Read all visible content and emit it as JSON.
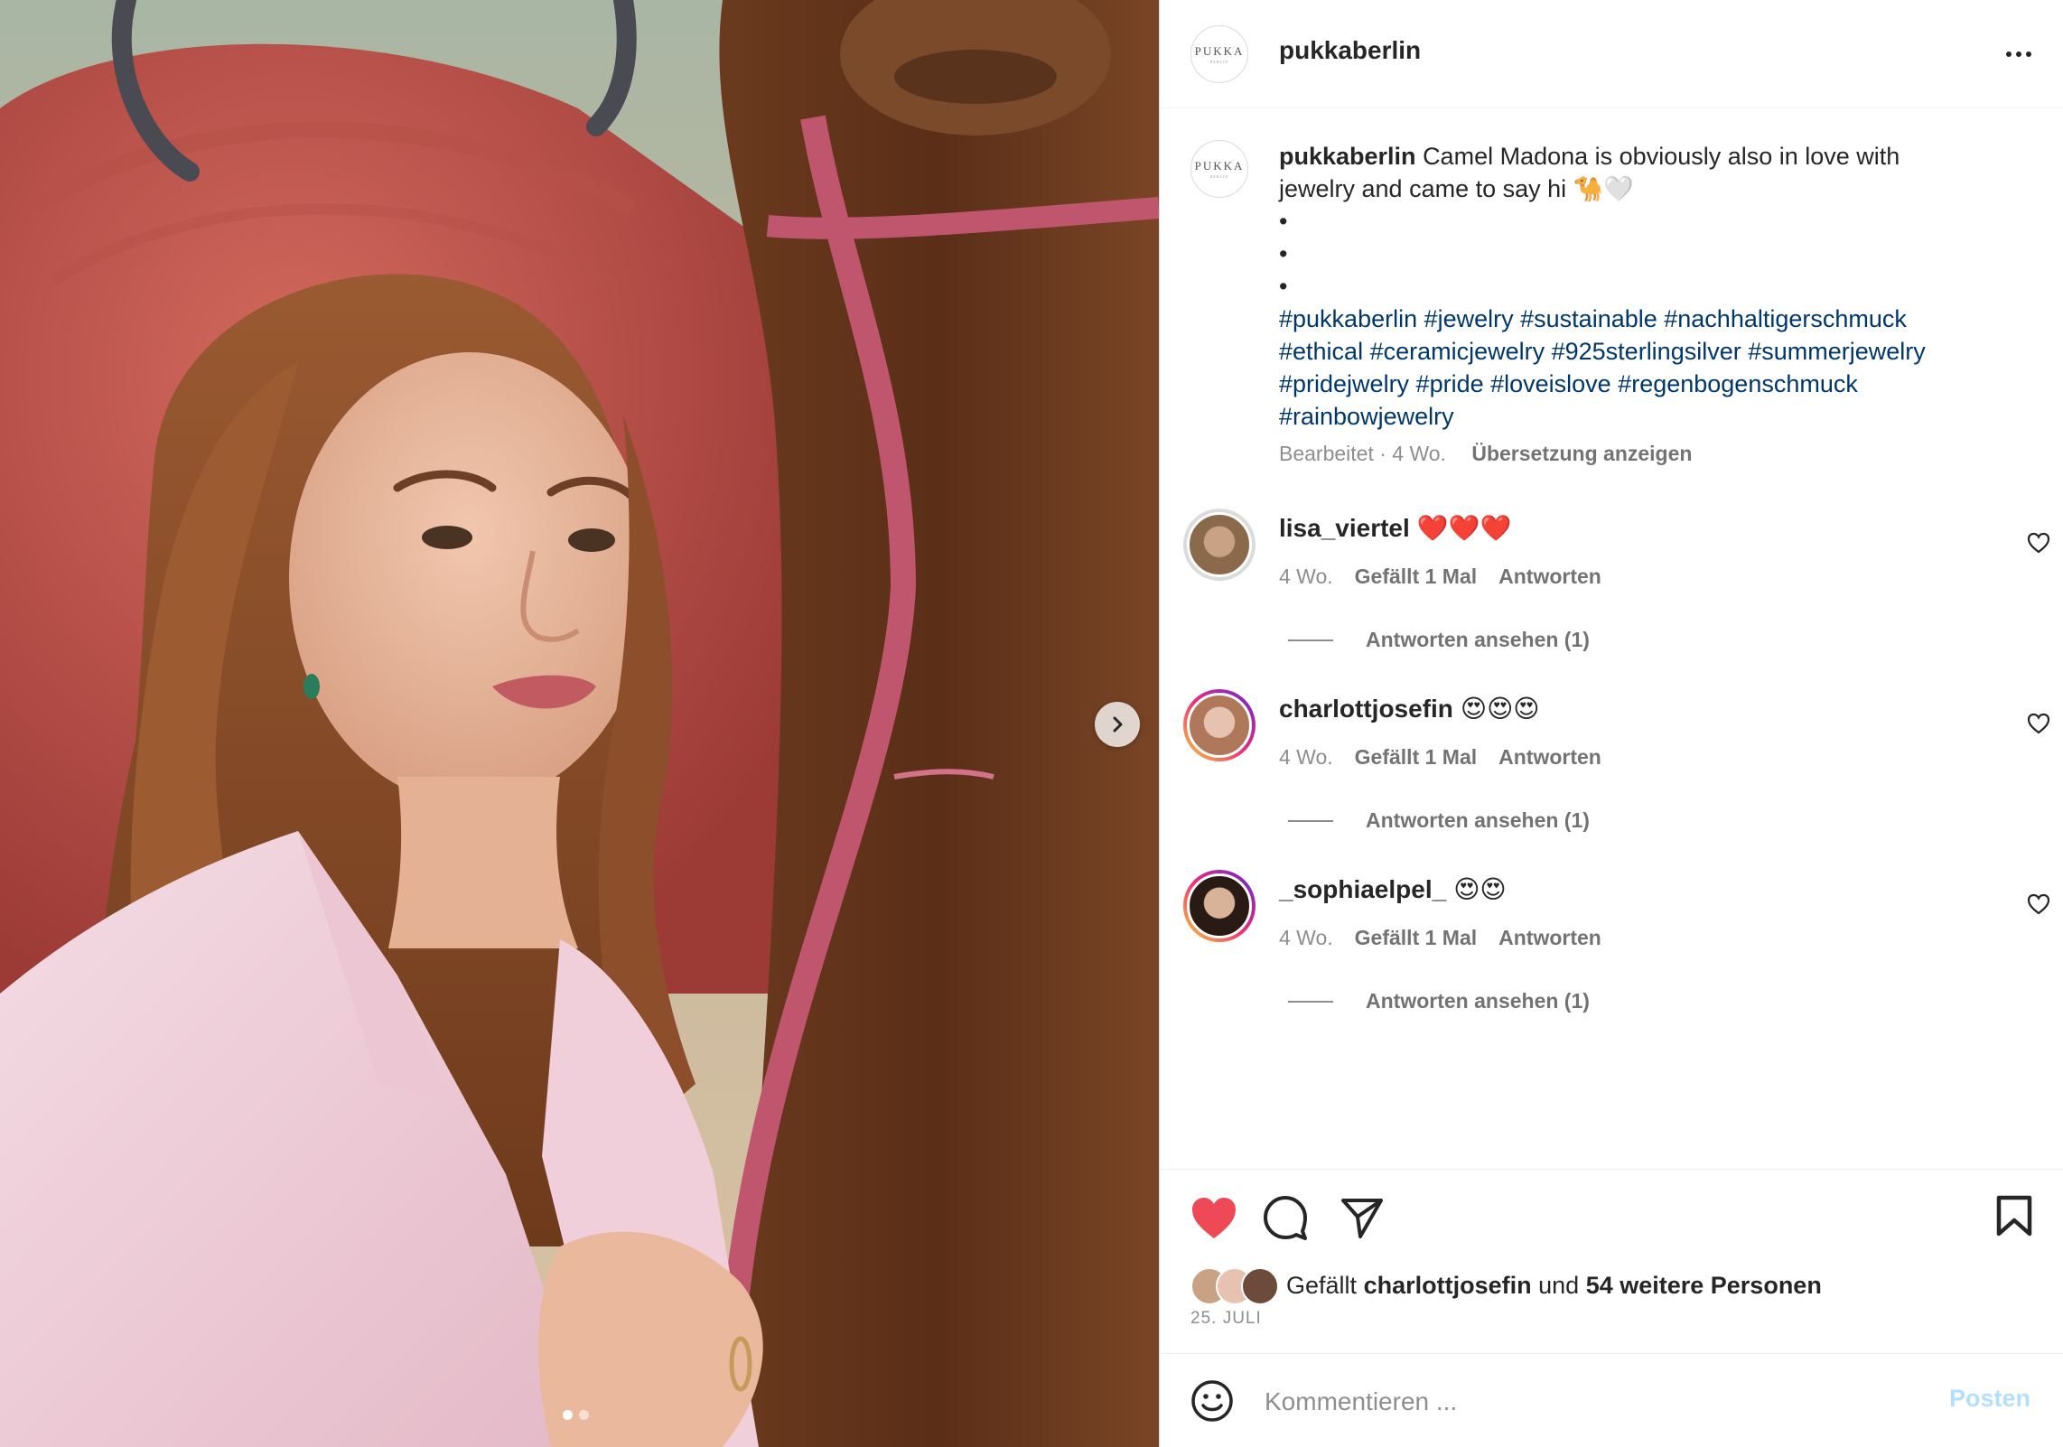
{
  "post": {
    "username": "pukkaberlin",
    "avatar_text": "PUKKA",
    "avatar_subtext": "BERLIN"
  },
  "caption": {
    "username": "pukkaberlin",
    "text_line1": "Camel Madona is obviously also in love with",
    "text_line2": "jewelry and came to say hi 🐪🤍",
    "bullets": [
      "•",
      "•",
      "•"
    ],
    "hashtags": [
      "#pukkaberlin #jewelry #sustainable #nachhaltigerschmuck",
      "#ethical #ceramicjewelry #925sterlingsilver #summerjewelry",
      "#pridejwelry #pride #loveislove #regenbogenschmuck",
      "#rainbowjewelry"
    ],
    "edited": "Bearbeitet · 4 Wo.",
    "translate": "Übersetzung anzeigen"
  },
  "comments": [
    {
      "username": "lisa_viertel",
      "text": "❤️❤️❤️",
      "age": "4 Wo.",
      "likes": "Gefällt 1 Mal",
      "reply": "Antworten",
      "view_replies": "Antworten ansehen (1)",
      "story_ring": false,
      "avatar_skin": "#c9a184",
      "avatar_hair": "#8a6a4a"
    },
    {
      "username": "charlottjosefin",
      "text": "😍😍😍",
      "age": "4 Wo.",
      "likes": "Gefällt 1 Mal",
      "reply": "Antworten",
      "view_replies": "Antworten ansehen (1)",
      "story_ring": true,
      "avatar_skin": "#e8c2b0",
      "avatar_hair": "#b0785a"
    },
    {
      "username": "_sophiaelpel_",
      "text": "😍😍",
      "age": "4 Wo.",
      "likes": "Gefällt 1 Mal",
      "reply": "Antworten",
      "view_replies": "Antworten ansehen (1)",
      "story_ring": true,
      "avatar_skin": "#d9b29a",
      "avatar_hair": "#2a1a14"
    }
  ],
  "likes": {
    "prefix": "Gefällt",
    "user": "charlottjosefin",
    "middle": "und",
    "others": "54 weitere Personen"
  },
  "date": "25. JULI",
  "comment_box": {
    "placeholder": "Kommentieren ...",
    "post_label": "Posten"
  },
  "carousel": {
    "total": 2,
    "active": 0
  },
  "icons": {
    "like": "heart-icon",
    "comment": "comment-icon",
    "share": "share-icon",
    "save": "bookmark-icon",
    "emoji": "emoji-icon",
    "more": "more-icon",
    "next": "chevron-right-icon"
  },
  "colors": {
    "liked_heart": "#ed4956",
    "hashtag": "#00376b",
    "muted": "#8e8e8e",
    "post_button_disabled": "#b2dffc",
    "story_ring_start": "#f9ce34",
    "story_ring_mid": "#ee2a7b",
    "story_ring_end": "#6228d7"
  }
}
